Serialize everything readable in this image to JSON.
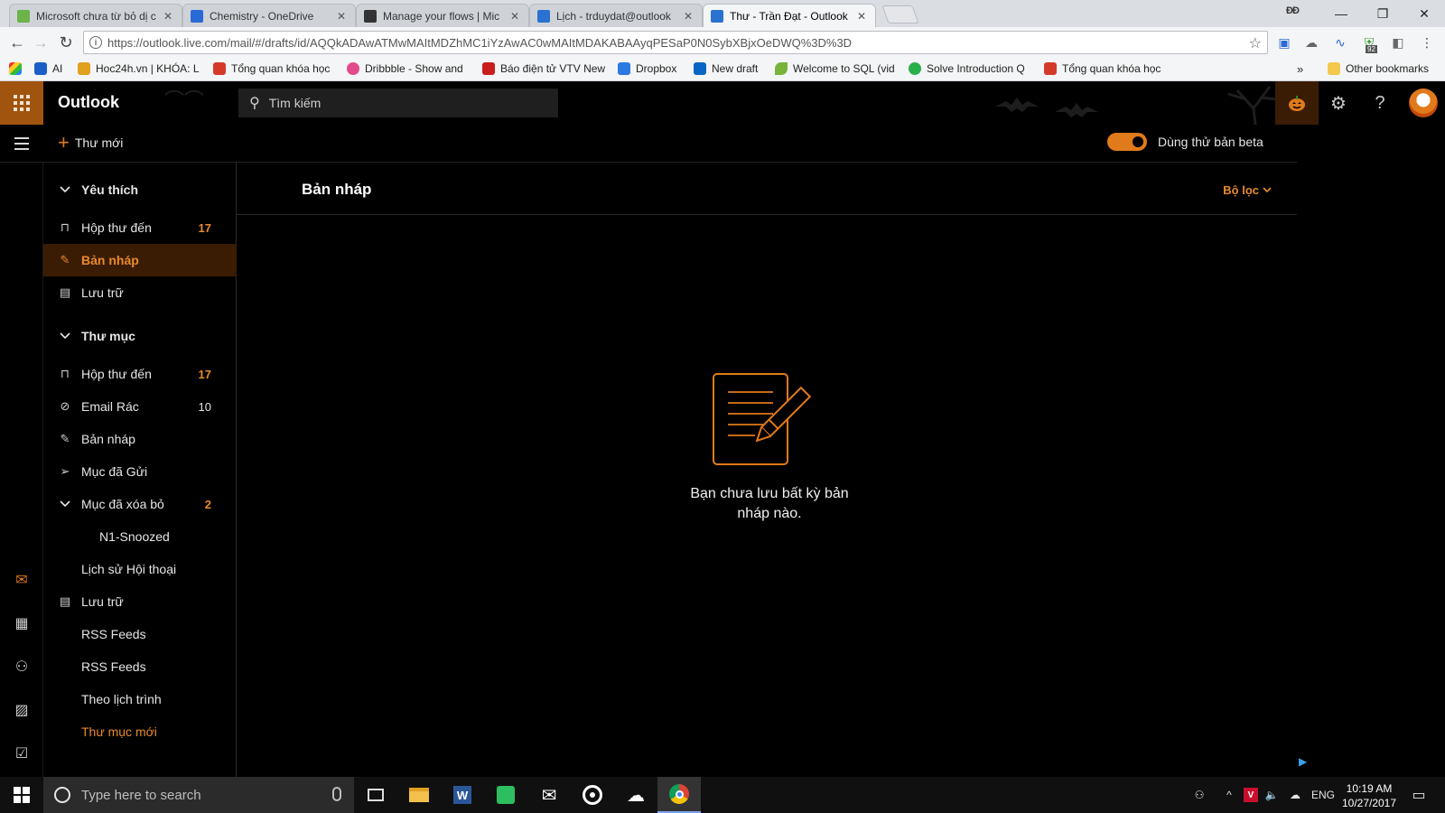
{
  "browser": {
    "tabs": [
      {
        "title": "Microsoft chưa từ bỏ dị c",
        "favicon_color": "#6bb34a"
      },
      {
        "title": "Chemistry - OneDrive",
        "favicon_color": "#2a6ad6"
      },
      {
        "title": "Manage your flows | Mic",
        "favicon_color": "#333333"
      },
      {
        "title": "Lịch - trduydat@outlook",
        "favicon_color": "#2a72d0"
      },
      {
        "title": "Thư - Trần Đạt - Outlook",
        "favicon_color": "#2a72d0"
      }
    ],
    "active_tab_index": 4,
    "url": "https://outlook.live.com/mail/#/drafts/id/AQQkADAwATMwMAItMDZhMC1iYzAwAC0wMAItMDAKABAAyqPESaP0N0SybXBjxOeDWQ%3D%3D",
    "bookmarks": [
      {
        "label": "AI",
        "color": "#1a5fc8"
      },
      {
        "label": "Hoc24h.vn | KHÓA: L",
        "color": "#e0a020"
      },
      {
        "label": "Tổng quan khóa học",
        "color": "#d43a2a"
      },
      {
        "label": "Dribbble - Show and",
        "color": "#e24a8a"
      },
      {
        "label": "Báo điện tử VTV New",
        "color": "#c81e1e"
      },
      {
        "label": "Dropbox",
        "color": "#2a7ae2"
      },
      {
        "label": "New draft",
        "color": "#0a66c2"
      },
      {
        "label": "Welcome to SQL (vid",
        "color": "#78b43c"
      },
      {
        "label": "Solve Introduction Q",
        "color": "#2ab04a"
      },
      {
        "label": "Tổng quan khóa học",
        "color": "#d43a2a"
      }
    ],
    "bookmarks_overflow": "»",
    "other_bookmarks": "Other bookmarks",
    "extension_badge": "92"
  },
  "outlook": {
    "brand": "Outlook",
    "search_placeholder": "Tìm kiếm",
    "new_mail_label": "Thư mới",
    "beta_label": "Dùng thử bản beta",
    "beta_enabled": true,
    "accent_color": "#e07a1a",
    "folder_pane": {
      "favorites_header": "Yêu thích",
      "favorites": [
        {
          "label": "Hộp thư đến",
          "count": "17",
          "icon": "inbox-icon"
        },
        {
          "label": "Bản nháp",
          "count": "",
          "icon": "pencil-icon",
          "active": true
        },
        {
          "label": "Lưu trữ",
          "count": "",
          "icon": "archive-icon"
        }
      ],
      "folders_header": "Thư mục",
      "folders": [
        {
          "label": "Hộp thư đến",
          "count": "17",
          "icon": "inbox-icon"
        },
        {
          "label": "Email Rác",
          "count": "10",
          "icon": "block-icon"
        },
        {
          "label": "Bản nháp",
          "count": "",
          "icon": "pencil-icon"
        },
        {
          "label": "Mục đã Gửi",
          "count": "",
          "icon": "send-icon"
        },
        {
          "label": "Mục đã xóa bỏ",
          "count": "2",
          "icon": "chevron-down-icon"
        },
        {
          "label": "N1-Snoozed",
          "count": "",
          "icon": ""
        },
        {
          "label": "Lịch sử Hội thoại",
          "count": "",
          "icon": ""
        },
        {
          "label": "Lưu trữ",
          "count": "",
          "icon": "archive-icon"
        },
        {
          "label": "RSS Feeds",
          "count": "",
          "icon": ""
        },
        {
          "label": "RSS Feeds",
          "count": "",
          "icon": ""
        },
        {
          "label": "Theo lịch trình",
          "count": "",
          "icon": ""
        }
      ],
      "new_folder_label": "Thư mục mới"
    },
    "main": {
      "title": "Bản nháp",
      "filter_label": "Bộ lọc",
      "empty_line1": "Bạn chưa lưu bất kỳ bản",
      "empty_line2": "nháp nào."
    }
  },
  "taskbar": {
    "search_placeholder": "Type here to search",
    "language": "ENG",
    "time": "10:19 AM",
    "date": "10/27/2017"
  }
}
